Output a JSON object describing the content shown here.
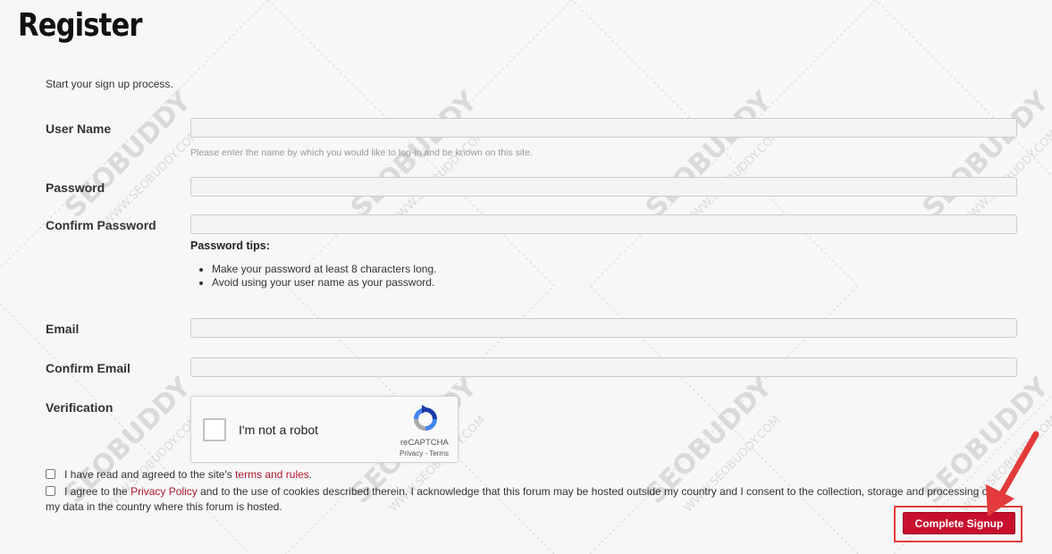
{
  "page": {
    "title": "Register",
    "intro": "Start your sign up process."
  },
  "form": {
    "username_label": "User Name",
    "username_value": "",
    "username_hint": "Please enter the name by which you would like to log-in and be known on this site.",
    "password_label": "Password",
    "password_value": "",
    "confirm_password_label": "Confirm Password",
    "confirm_password_value": "",
    "password_tips_title": "Password tips:",
    "password_tips": [
      "Make your password at least 8 characters long.",
      "Avoid using your user name as your password."
    ],
    "email_label": "Email",
    "email_value": "",
    "confirm_email_label": "Confirm Email",
    "confirm_email_value": "",
    "verification_label": "Verification"
  },
  "captcha": {
    "label": "I'm not a robot",
    "brand": "reCAPTCHA",
    "privacy": "Privacy",
    "separator": " - ",
    "terms": "Terms"
  },
  "agreements": {
    "terms_prefix": "I have read and agreed to the site's ",
    "terms_link": "terms and rules",
    "terms_suffix": ".",
    "privacy_prefix": "I agree to the ",
    "privacy_link": "Privacy Policy",
    "privacy_suffix": " and to the use of cookies described therein. I acknowledge that this forum may be hosted outside my country and I consent to the collection, storage and processing of my data in the country where this forum is hosted."
  },
  "actions": {
    "submit_label": "Complete Signup"
  },
  "watermark": {
    "text": "SEOBUDDY",
    "subtext": "WWW.SEOBUDDY.COM"
  },
  "colors": {
    "accent": "#c8102e",
    "link": "#b0172c",
    "highlight": "#e33b3b"
  }
}
